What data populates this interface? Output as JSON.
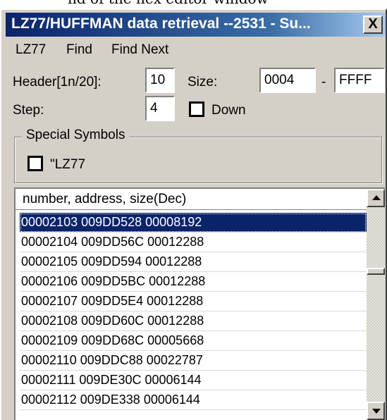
{
  "caption_fragment": "nd of the hex editor window",
  "window": {
    "title": "LZ77/HUFFMAN data retrieval --2531 - Su...",
    "close_label": "X"
  },
  "menu": [
    "LZ77",
    "Find",
    "Find Next"
  ],
  "form": {
    "header_label": "Header[1n/20]:",
    "header_value": "10",
    "size_label": "Size:",
    "size_from": "0004",
    "size_dash": "-",
    "size_to": "FFFF",
    "step_label": "Step:",
    "step_value": "4",
    "down_label": "Down",
    "down_checked": false
  },
  "special_symbols": {
    "legend": "Special Symbols",
    "lz77_label": "\"LZ77",
    "lz77_checked": false
  },
  "list": {
    "header": "number, address, size(Dec)",
    "selected_index": 0,
    "rows": [
      "00002103 009DD528 00008192",
      "00002104 009DD56C 00012288",
      "00002105 009DD594 00012288",
      "00002106 009DD5BC 00012288",
      "00002107 009DD5E4 00012288",
      "00002108 009DD60C 00012288",
      "00002109 009DD68C 00005668",
      "00002110 009DDC88 00022787",
      "00002111 009DE30C 00006144",
      "00002112 009DE338 00006144"
    ]
  }
}
